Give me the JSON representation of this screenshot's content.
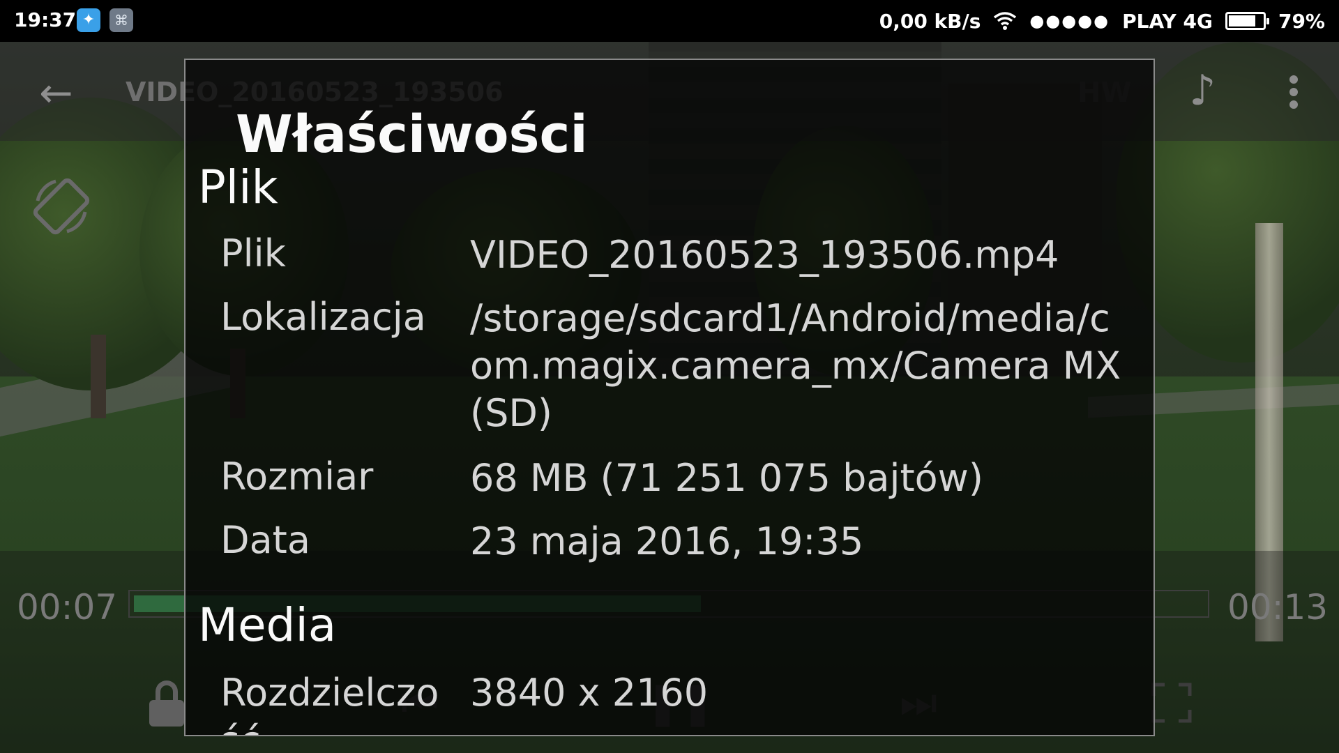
{
  "status_bar": {
    "time": "19:37",
    "notification_icons": [
      "twitter-icon",
      "app-icon"
    ],
    "network_speed": "0,00 kB/s",
    "signal_dots": "●●●●●",
    "carrier": "PLAY 4G",
    "battery_percent": "79%",
    "battery_level": 0.79
  },
  "player": {
    "title": "VIDEO_20160523_193506",
    "decoder_label": "HW",
    "current_time": "00:07",
    "total_time": "00:13",
    "progress": 0.53
  },
  "dialog": {
    "title": "Właściwości",
    "sections": {
      "file": {
        "heading": "Plik",
        "rows": [
          {
            "label": "Plik",
            "value": "VIDEO_20160523_193506.mp4"
          },
          {
            "label": "Lokalizacja",
            "value": "/storage/sdcard1/Android/media/com.magix.camera_mx/Camera MX (SD)"
          },
          {
            "label": "Rozmiar",
            "value": "68 MB (71 251 075 bajtów)"
          },
          {
            "label": "Data",
            "value": "23 maja 2016, 19:35"
          }
        ]
      },
      "media": {
        "heading": "Media",
        "rows": [
          {
            "label": "Rozdzielczość",
            "value": "3840 x 2160"
          }
        ]
      }
    }
  },
  "colors": {
    "accent_progress": "#2f6a3e",
    "status_bar_bg": "#000000",
    "dialog_border": "#8a8a8a"
  }
}
